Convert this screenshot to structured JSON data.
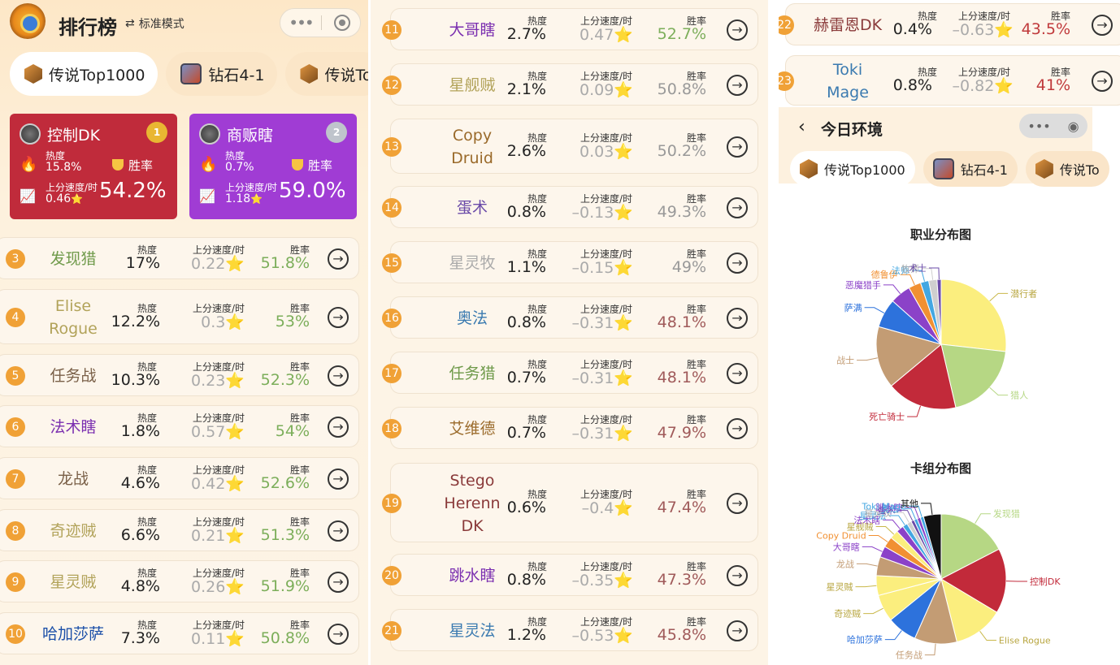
{
  "app": {
    "title": "排行榜",
    "mode_label": "标准模式"
  },
  "tabs": [
    {
      "label": "传说Top1000",
      "icon": "legend-hex-icon"
    },
    {
      "label": "钻石4-1",
      "icon": "diamond-rank-icon"
    },
    {
      "label": "传说To",
      "icon": "legend-hex-icon"
    }
  ],
  "labels": {
    "heat": "热度",
    "speed": "上分速度/时",
    "winrate": "胜率",
    "star": "⭐"
  },
  "top": [
    {
      "rank": 1,
      "name": "控制DK",
      "heat": "15.8%",
      "speed": "0.46",
      "winrate": "54.2%",
      "color": "#c02b3b",
      "medal": "1"
    },
    {
      "rank": 2,
      "name": "商贩瞎",
      "heat": "0.7%",
      "speed": "1.18",
      "winrate": "59.0%",
      "color": "#a03cd4",
      "medal": "2"
    }
  ],
  "decks": [
    {
      "rank": "3",
      "name": "发现猎",
      "color": "#6f9a4a",
      "heat": "17%",
      "speed": "0.22",
      "winrate": "51.8%",
      "wrcolor": "#7cae5a"
    },
    {
      "rank": "4",
      "name": "Elise Rogue",
      "color": "#b2a35a",
      "heat": "12.2%",
      "speed": "0.3",
      "winrate": "53%",
      "wrcolor": "#7cae5a"
    },
    {
      "rank": "5",
      "name": "任务战",
      "color": "#7a6048",
      "heat": "10.3%",
      "speed": "0.23",
      "winrate": "52.3%",
      "wrcolor": "#7cae5a"
    },
    {
      "rank": "6",
      "name": "法术瞎",
      "color": "#7b2fb0",
      "heat": "1.8%",
      "speed": "0.57",
      "winrate": "54%",
      "wrcolor": "#7cae5a"
    },
    {
      "rank": "7",
      "name": "龙战",
      "color": "#7a6048",
      "heat": "4.6%",
      "speed": "0.42",
      "winrate": "52.6%",
      "wrcolor": "#7cae5a"
    },
    {
      "rank": "8",
      "name": "奇迹贼",
      "color": "#b2a35a",
      "heat": "6.6%",
      "speed": "0.21",
      "winrate": "51.3%",
      "wrcolor": "#7cae5a"
    },
    {
      "rank": "9",
      "name": "星灵贼",
      "color": "#b2a35a",
      "heat": "4.8%",
      "speed": "0.26",
      "winrate": "51.9%",
      "wrcolor": "#7cae5a"
    },
    {
      "rank": "10",
      "name": "哈加莎萨",
      "color": "#1b4fa8",
      "heat": "7.3%",
      "speed": "0.11",
      "winrate": "50.8%",
      "wrcolor": "#7cae5a"
    },
    {
      "rank": "11",
      "name": "大哥瞎",
      "color": "#7b2fb0",
      "heat": "2.7%",
      "speed": "0.47",
      "winrate": "52.7%",
      "wrcolor": "#7cae5a"
    },
    {
      "rank": "12",
      "name": "星舰贼",
      "color": "#b2a35a",
      "heat": "2.1%",
      "speed": "0.09",
      "winrate": "50.8%",
      "wrcolor": "#999"
    },
    {
      "rank": "13",
      "name": "Copy Druid",
      "color": "#9a6a2a",
      "heat": "2.6%",
      "speed": "0.03",
      "winrate": "50.2%",
      "wrcolor": "#999"
    },
    {
      "rank": "14",
      "name": "蛋术",
      "color": "#6a4aa8",
      "heat": "0.8%",
      "speed": "–0.13",
      "winrate": "49.3%",
      "wrcolor": "#999"
    },
    {
      "rank": "15",
      "name": "星灵牧",
      "color": "#aaaaaa",
      "heat": "1.1%",
      "speed": "–0.15",
      "winrate": "49%",
      "wrcolor": "#999"
    },
    {
      "rank": "16",
      "name": "奥法",
      "color": "#3a7ab0",
      "heat": "0.8%",
      "speed": "–0.31",
      "winrate": "48.1%",
      "wrcolor": "#a05a5a"
    },
    {
      "rank": "17",
      "name": "任务猎",
      "color": "#6f9a4a",
      "heat": "0.7%",
      "speed": "–0.31",
      "winrate": "48.1%",
      "wrcolor": "#a05a5a"
    },
    {
      "rank": "18",
      "name": "艾维德",
      "color": "#9a6a2a",
      "heat": "0.7%",
      "speed": "–0.31",
      "winrate": "47.9%",
      "wrcolor": "#a05a5a"
    },
    {
      "rank": "19",
      "name": "Stego Herenn DK",
      "color": "#8a3a3a",
      "heat": "0.6%",
      "speed": "–0.4",
      "winrate": "47.4%",
      "wrcolor": "#a05a5a"
    },
    {
      "rank": "20",
      "name": "跳水瞎",
      "color": "#7b2fb0",
      "heat": "0.8%",
      "speed": "–0.35",
      "winrate": "47.3%",
      "wrcolor": "#a05a5a"
    },
    {
      "rank": "21",
      "name": "星灵法",
      "color": "#3a7ab0",
      "heat": "1.2%",
      "speed": "–0.53",
      "winrate": "45.8%",
      "wrcolor": "#a05a5a"
    },
    {
      "rank": "22",
      "name": "赫雷恩DK",
      "color": "#8a3a3a",
      "heat": "0.4%",
      "speed": "–0.63",
      "winrate": "43.5%",
      "wrcolor": "#c0393b"
    },
    {
      "rank": "23",
      "name": "Toki Mage",
      "color": "#3a7ab0",
      "heat": "0.8%",
      "speed": "–0.82",
      "winrate": "41%",
      "wrcolor": "#c0393b"
    }
  ],
  "env": {
    "title": "今日环境",
    "tabs": [
      "传说Top1000",
      "钻石4-1",
      "传说To"
    ]
  },
  "chart_data": [
    {
      "type": "pie",
      "title": "职业分布图",
      "categories": [
        "潜行者",
        "猎人",
        "死亡骑士",
        "战士",
        "萨满",
        "恶魔猎手",
        "德鲁伊",
        "法师",
        "牧师",
        "术士"
      ],
      "values": [
        26,
        19,
        17,
        15,
        7,
        5,
        3,
        2,
        2,
        1
      ],
      "colors": [
        "#fbee7e",
        "#b6d784",
        "#c22a3a",
        "#c39c74",
        "#2d72dc",
        "#8b42c8",
        "#f19032",
        "#43a7e2",
        "#cfcfcf",
        "#6a4aa8"
      ]
    },
    {
      "type": "pie",
      "title": "卡组分布图",
      "categories": [
        "发现猎",
        "控制DK",
        "Elise Rogue",
        "任务战",
        "哈加莎萨",
        "奇迹贼",
        "星灵贼",
        "龙战",
        "大哥瞎",
        "Copy Druid",
        "星舰贼",
        "法术瞎",
        "星灵法",
        "星灵牧",
        "蛋术",
        "奥法",
        "跳水瞎",
        "Toki Mage",
        "其他"
      ],
      "values": [
        17,
        15.8,
        12.2,
        10.3,
        7.3,
        6.6,
        4.8,
        4.6,
        2.7,
        2.6,
        2.1,
        1.8,
        1.2,
        1.1,
        0.8,
        0.8,
        0.8,
        0.8,
        4.3
      ],
      "colors": [
        "#b6d784",
        "#c22a3a",
        "#fbee7e",
        "#c39c74",
        "#2d72dc",
        "#fbee7e",
        "#fbee7e",
        "#c39c74",
        "#8b42c8",
        "#f19032",
        "#fbee7e",
        "#8b42c8",
        "#43a7e2",
        "#cfcfcf",
        "#6a4aa8",
        "#43a7e2",
        "#8b42c8",
        "#43a7e2",
        "#111111"
      ]
    }
  ]
}
